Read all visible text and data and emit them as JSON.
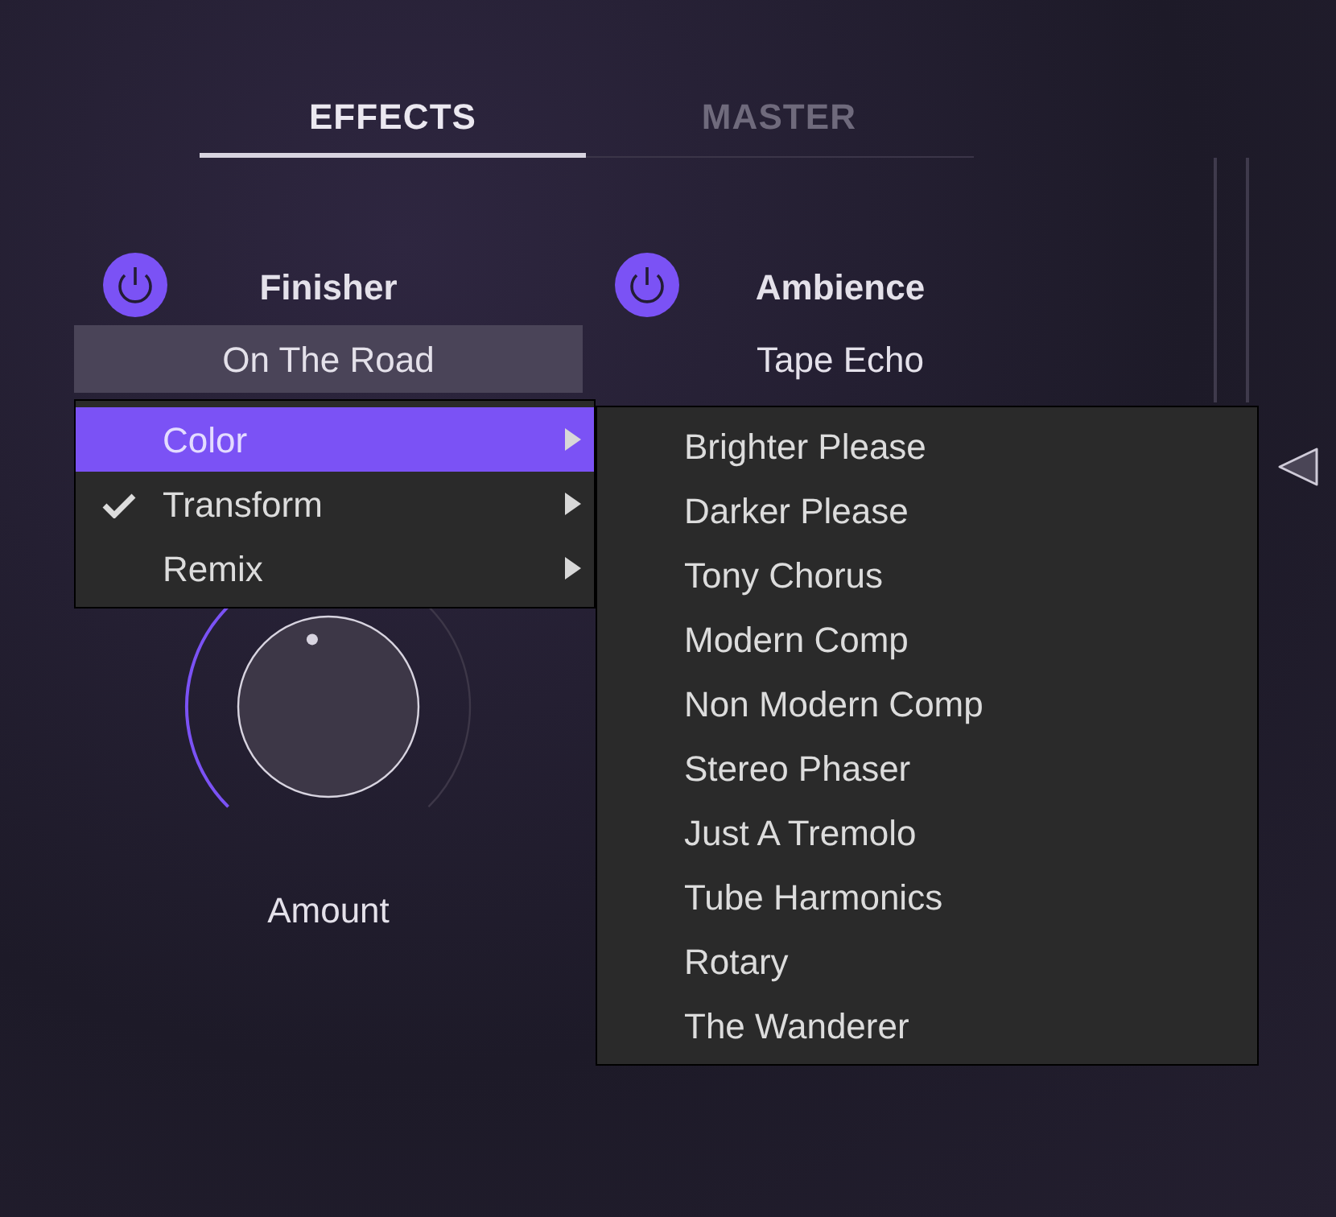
{
  "tabs": [
    {
      "label": "EFFECTS",
      "selected": true
    },
    {
      "label": "MASTER",
      "selected": false
    }
  ],
  "modules": [
    {
      "title": "Finisher",
      "on": true,
      "preset": "On The Road",
      "preset_open": true
    },
    {
      "title": "Ambience",
      "on": true,
      "preset": "Tape Echo",
      "preset_open": false
    }
  ],
  "knob": {
    "label": "Amount"
  },
  "menu": {
    "items": [
      {
        "label": "Color",
        "selected": true,
        "checked": false
      },
      {
        "label": "Transform",
        "selected": false,
        "checked": true
      },
      {
        "label": "Remix",
        "selected": false,
        "checked": false
      }
    ]
  },
  "submenu": {
    "items": [
      "Brighter Please",
      "Darker Please",
      "Tony Chorus",
      "Modern Comp",
      "Non Modern Comp",
      "Stereo Phaser",
      "Just A Tremolo",
      "Tube Harmonics",
      "Rotary",
      "The Wanderer"
    ]
  }
}
